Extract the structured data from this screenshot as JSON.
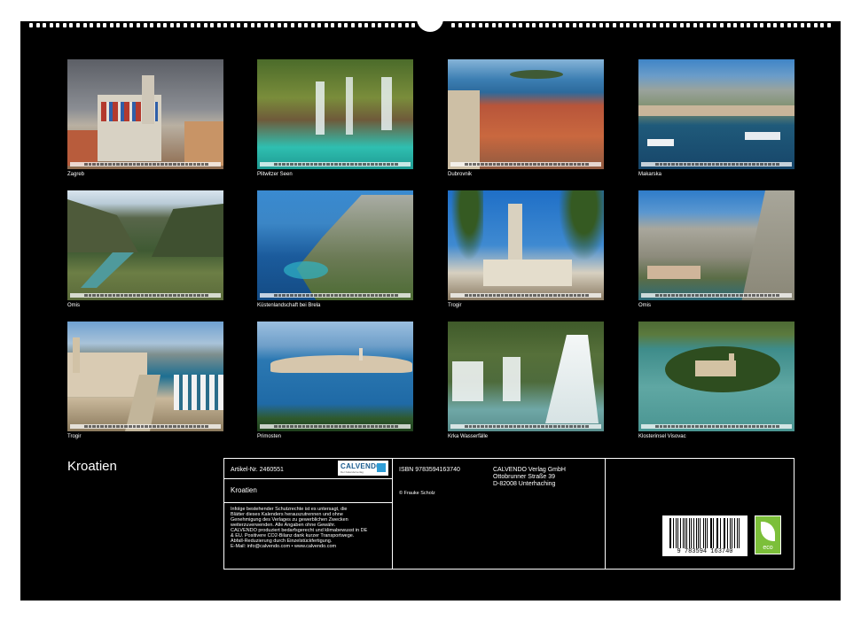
{
  "calendar_title": "Kroatien",
  "photos": [
    {
      "caption": "Zagreb"
    },
    {
      "caption": "Plitwitzer Seen"
    },
    {
      "caption": "Dubrovnik"
    },
    {
      "caption": "Makarska"
    },
    {
      "caption": "Omis"
    },
    {
      "caption": "Küstenlandschaft bei Brela"
    },
    {
      "caption": "Trogir"
    },
    {
      "caption": "Omis"
    },
    {
      "caption": "Trogir"
    },
    {
      "caption": "Primosten"
    },
    {
      "caption": "Krka Wasserfälle"
    },
    {
      "caption": "Klosterinsel Visovac"
    }
  ],
  "info": {
    "article_no": "Artikel-Nr. 2460551",
    "logo_name": "CALVENDO",
    "logo_sub": "Der Kalenderverlag",
    "title": "Kroatien",
    "legal_lines": [
      "Infolge bestehender Schutzrechte ist es untersagt, die",
      "Blätter dieses Kalenders herauszutrennen und ohne",
      "Genehmigung des Verlages zu gewerblichen Zwecken",
      "weiterzuverwenden. Alle Angaben ohne Gewähr.",
      "CALVENDO produziert bedarfsgerecht und klimabewusst in DE",
      "& EU. Positivere CO2-Bilanz dank kurzer Transportwege.",
      "Abfall-Reduzierung durch Einzelstückfertigung.",
      "E-Mail: info@calvendo.com • www.calvendo.com"
    ],
    "isbn": "ISBN 9783594163740",
    "copyright": "© Frauke Scholz",
    "publisher_lines": [
      "CALVENDO Verlag GmbH",
      "Ottobrunner Straße 39",
      "D-82008 Unterhaching"
    ],
    "barcode_number": "9 783594 163740",
    "eco_label": "eco"
  },
  "colors": {
    "background": "#000000",
    "page": "#ffffff",
    "text": "#ffffff",
    "eco": "#7cbf3a",
    "logo": "#1a5c8f"
  }
}
